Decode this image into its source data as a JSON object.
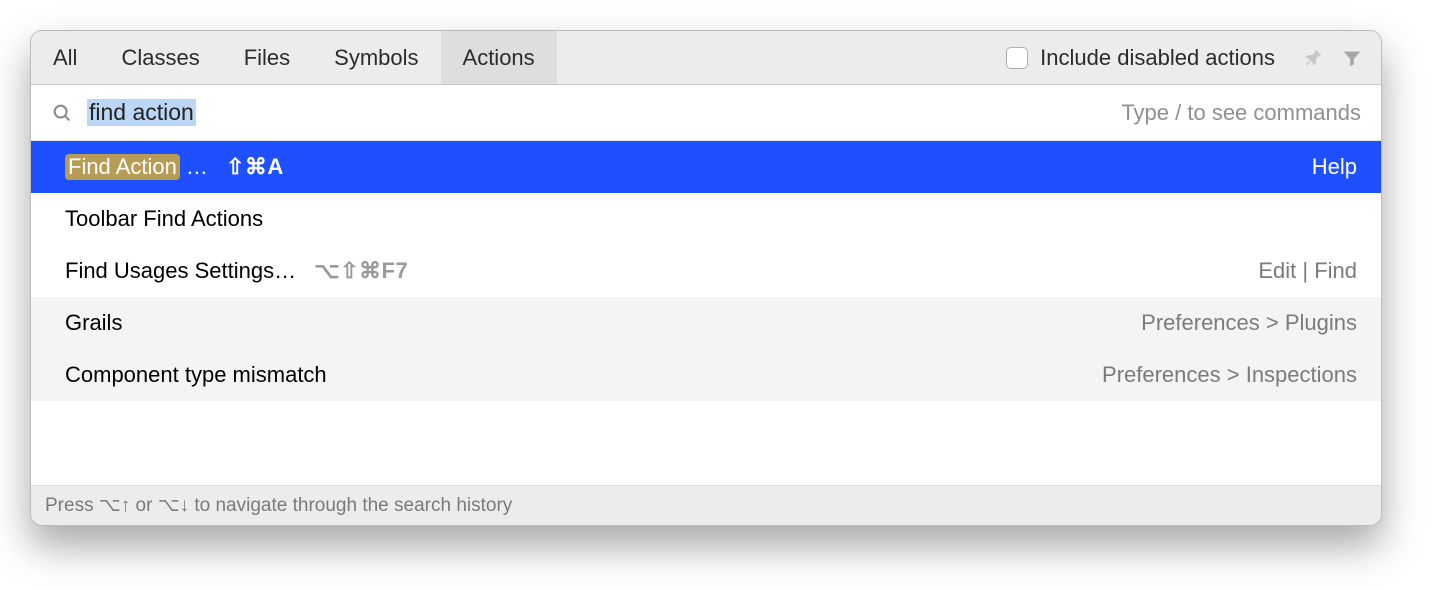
{
  "tabs": {
    "items": [
      {
        "label": "All",
        "active": false
      },
      {
        "label": "Classes",
        "active": false
      },
      {
        "label": "Files",
        "active": false
      },
      {
        "label": "Symbols",
        "active": false
      },
      {
        "label": "Actions",
        "active": true
      }
    ]
  },
  "toolbar": {
    "include_disabled_label": "Include disabled actions",
    "include_disabled_checked": false
  },
  "search": {
    "query": "find action",
    "hint": "Type / to see commands"
  },
  "results": [
    {
      "selected": true,
      "alt": false,
      "label_prefix_hi": "Find Action",
      "label_suffix": "…",
      "shortcut": "⇧⌘A",
      "shortcut_muted": false,
      "location": "Help",
      "location_muted": false
    },
    {
      "selected": false,
      "alt": false,
      "label_prefix_hi": "",
      "label_suffix": "Toolbar Find Actions",
      "shortcut": "",
      "shortcut_muted": false,
      "location": "",
      "location_muted": false
    },
    {
      "selected": false,
      "alt": false,
      "label_prefix_hi": "",
      "label_suffix": "Find Usages Settings…",
      "shortcut": "⌥⇧⌘F7",
      "shortcut_muted": true,
      "location": "Edit | Find",
      "location_muted": true
    },
    {
      "selected": false,
      "alt": true,
      "label_prefix_hi": "",
      "label_suffix": "Grails",
      "shortcut": "",
      "shortcut_muted": false,
      "location": "Preferences > Plugins",
      "location_muted": true
    },
    {
      "selected": false,
      "alt": true,
      "label_prefix_hi": "",
      "label_suffix": "Component type mismatch",
      "shortcut": "",
      "shortcut_muted": false,
      "location": "Preferences > Inspections",
      "location_muted": true
    }
  ],
  "footer": {
    "text": "Press ⌥↑ or ⌥↓ to navigate through the search history"
  }
}
